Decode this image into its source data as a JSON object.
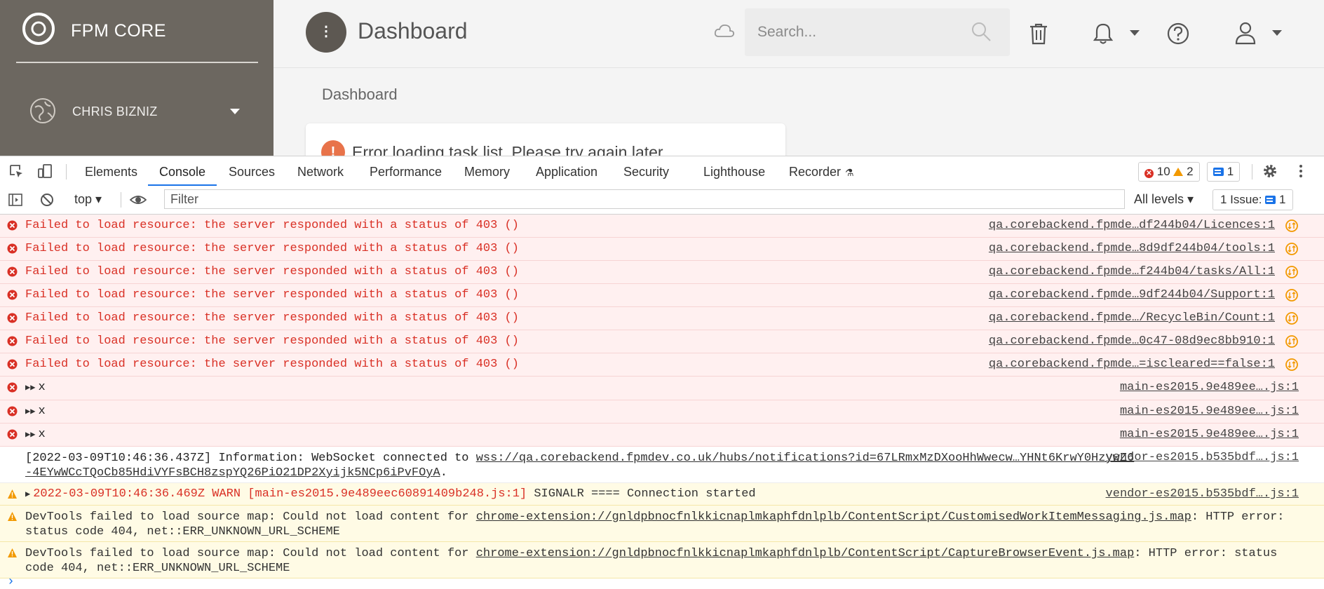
{
  "app": {
    "name": "FPM CORE",
    "org_name": "CHRIS BIZNIZ",
    "page_title": "Dashboard",
    "breadcrumb": "Dashboard",
    "search_placeholder": "Search...",
    "menu_glyph": "⋮",
    "error_card_text": "Error loading task list. Please try again later"
  },
  "devtools": {
    "tabs": [
      "Elements",
      "Console",
      "Sources",
      "Network",
      "Performance",
      "Memory",
      "Application",
      "Security",
      "Lighthouse",
      "Recorder"
    ],
    "active_tab": "Console",
    "error_count": "10",
    "warning_count": "2",
    "message_count": "1",
    "context": "top",
    "filter_placeholder": "Filter",
    "levels_label": "All levels",
    "issues_label": "1 Issue:",
    "issues_count": "1"
  },
  "console": {
    "errors": [
      {
        "text": "Failed to load resource: the server responded with a status of 403 ()",
        "source": "qa.corebackend.fpmde…df244b04/Licences:1"
      },
      {
        "text": "Failed to load resource: the server responded with a status of 403 ()",
        "source": "qa.corebackend.fpmde…8d9df244b04/tools:1"
      },
      {
        "text": "Failed to load resource: the server responded with a status of 403 ()",
        "source": "qa.corebackend.fpmde…f244b04/tasks/All:1"
      },
      {
        "text": "Failed to load resource: the server responded with a status of 403 ()",
        "source": "qa.corebackend.fpmde…9df244b04/Support:1"
      },
      {
        "text": "Failed to load resource: the server responded with a status of 403 ()",
        "source": "qa.corebackend.fpmde…/RecycleBin/Count:1"
      },
      {
        "text": "Failed to load resource: the server responded with a status of 403 ()",
        "source": "qa.corebackend.fpmde…0c47-08d9ec8bb910:1"
      },
      {
        "text": "Failed to load resource: the server responded with a status of 403 ()",
        "source": "qa.corebackend.fpmde…=iscleared==false:1"
      }
    ],
    "x_errors": [
      {
        "text": "x",
        "source": "main-es2015.9e489ee….js:1"
      },
      {
        "text": "x",
        "source": "main-es2015.9e489ee….js:1"
      },
      {
        "text": "x",
        "source": "main-es2015.9e489ee….js:1"
      }
    ],
    "info": {
      "prefix": "[2022-03-09T10:46:36.437Z] Information: WebSocket connected to ",
      "url_line1": "wss://qa.corebackend.fpmdev.co.uk/hubs/notifications?id=67LRmxMzDXooHhWwecw…YHNt6KrwY0HzywZ6",
      "url_line2": "-4EYwWCcTQoCb85HdiVYFsBCH8zspYQ26PiO21DP2Xyijk5NCp6iPvFOyA",
      "suffix": ".",
      "source": "vendor-es2015.b535bdf….js:1"
    },
    "warn_signalr": {
      "red_text": "2022-03-09T10:46:36.469Z WARN [main-es2015.9e489eec60891409b248.js:1]",
      "text": " SIGNALR ==== Connection started",
      "source": "vendor-es2015.b535bdf….js:1"
    },
    "warn_sourcemap_1": {
      "prefix": "DevTools failed to load source map: Could not load content for ",
      "url": "chrome-extension://gnldpbnocfnlkkicnaplmkaphfdnlplb/ContentScript/CustomisedWorkItemMessaging.js.map",
      "suffix": ": HTTP error: status code 404, net::ERR_UNKNOWN_URL_SCHEME"
    },
    "warn_sourcemap_2": {
      "prefix": "DevTools failed to load source map: Could not load content for ",
      "url": "chrome-extension://gnldpbnocfnlkkicnaplmkaphfdnlplb/ContentScript/CaptureBrowserEvent.js.map",
      "suffix": ": HTTP error: status code 404, net::ERR_UNKNOWN_URL_SCHEME"
    }
  },
  "colors": {
    "sidebar": "#6c6760",
    "error_text": "#d93025",
    "error_bg": "#fff0f0",
    "warn_bg": "#fffbe5",
    "accent": "#1a73e8"
  },
  "icons": [
    "logo-icon",
    "org-icon",
    "cloud-icon",
    "search-icon",
    "trash-icon",
    "bell-icon",
    "help-icon",
    "user-icon",
    "inspect-icon",
    "device-icon",
    "block-icon",
    "eye-icon",
    "gear-icon",
    "kebab-icon",
    "network-request-icon"
  ]
}
